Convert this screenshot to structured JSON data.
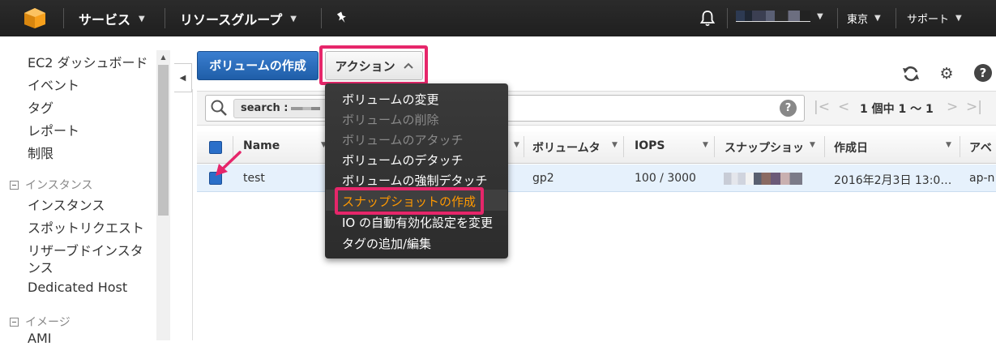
{
  "nav": {
    "services": "サービス",
    "resource_groups": "リソースグループ",
    "region": "東京",
    "support": "サポート"
  },
  "sidebar": {
    "items": [
      "EC2 ダッシュボード",
      "イベント",
      "タグ",
      "レポート",
      "制限"
    ],
    "section_instances": "インスタンス",
    "instance_items": [
      "インスタンス",
      "スポットリクエスト",
      "リザーブドインスタ",
      "ンス",
      "Dedicated Host"
    ],
    "section_images": "イメージ",
    "image_items": [
      "AMI"
    ]
  },
  "toolbar": {
    "create_label": "ボリュームの作成",
    "action_label": "アクション"
  },
  "search": {
    "tag_label": "search :",
    "pager_text": "1 個中 1 ～ 1"
  },
  "table": {
    "columns": [
      "Name",
      "ボリュームタ",
      "IOPS",
      "スナップショッ",
      "作成日",
      "アベ"
    ],
    "row": {
      "name": "test",
      "volume_type": "gp2",
      "iops": "100 / 3000",
      "created": "2016年2月3日 13:0…",
      "az": "ap-n"
    }
  },
  "menu": {
    "items": [
      {
        "label": "ボリュームの変更",
        "disabled": false
      },
      {
        "label": "ボリュームの削除",
        "disabled": true
      },
      {
        "label": "ボリュームのアタッチ",
        "disabled": true
      },
      {
        "label": "ボリュームのデタッチ",
        "disabled": false
      },
      {
        "label": "ボリュームの強制デタッチ",
        "disabled": false
      },
      {
        "label": "スナップショットの作成",
        "disabled": false,
        "highlighted": true
      },
      {
        "label": "IO の自動有効化設定を変更",
        "disabled": false
      },
      {
        "label": "タグの追加/編集",
        "disabled": false
      }
    ]
  },
  "colors": {
    "highlight": "#e6266a",
    "primary_button": "#2d6bb8",
    "menu_bg": "#333333",
    "menu_active_text": "#ff9900"
  },
  "icons": [
    "aws-logo-icon",
    "bell-icon",
    "pin-icon",
    "refresh-icon",
    "gear-icon",
    "help-icon",
    "search-icon"
  ]
}
